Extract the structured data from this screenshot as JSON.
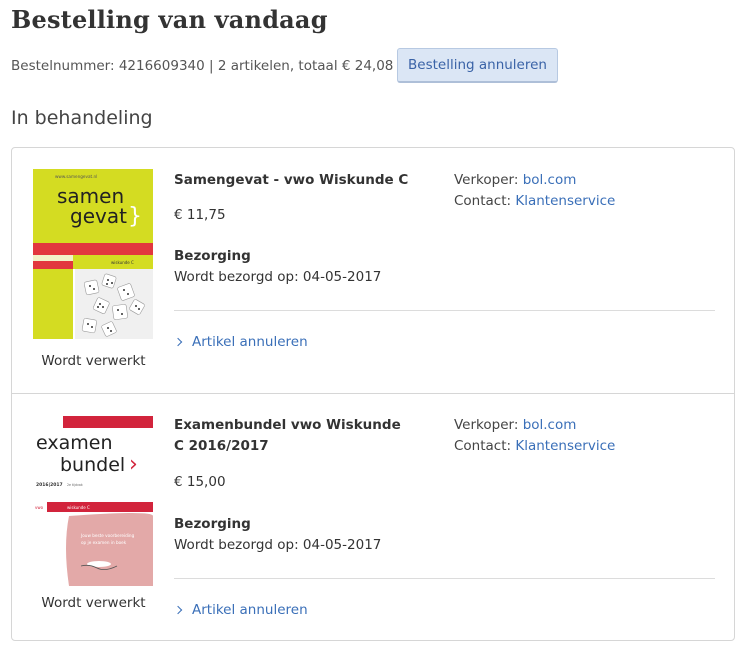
{
  "page": {
    "title": "Bestelling van vandaag",
    "order_summary": "Bestelnummer: 4216609340 | 2 artikelen, totaal € 24,08",
    "cancel_order_label": "Bestelling annuleren",
    "section_heading": "In behandeling"
  },
  "items": [
    {
      "title": "Samengevat - vwo Wiskunde C",
      "price": "€ 11,75",
      "delivery_label": "Bezorging",
      "delivery_date": "Wordt bezorgd op: 04-05-2017",
      "seller_label": "Verkoper:",
      "seller_name": "bol.com",
      "contact_label": "Contact:",
      "contact_name": "Klantenservice",
      "cancel_label": "Artikel annuleren",
      "status": "Wordt verwerkt",
      "cover": {
        "line1": "samen",
        "line2": "gevat",
        "site": "www.samengevat.nl",
        "subject": "wiskunde C",
        "level": "vwo"
      }
    },
    {
      "title": "Examenbundel vwo Wiskunde C 2016/2017",
      "price": "€ 15,00",
      "delivery_label": "Bezorging",
      "delivery_date": "Wordt bezorgd op: 04-05-2017",
      "seller_label": "Verkoper:",
      "seller_name": "bol.com",
      "contact_label": "Contact:",
      "contact_name": "Klantenservice",
      "cancel_label": "Artikel annuleren",
      "status": "Wordt verwerkt",
      "cover": {
        "line1": "examen",
        "line2": "bundel",
        "year": "2016|2017",
        "level": "vwo",
        "subject": "wiskunde C",
        "tagline1": "Jouw beste voorbereiding",
        "tagline2": "op je examen in boek"
      }
    }
  ],
  "colors": {
    "link": "#3a6fb8",
    "button_bg": "#dbe6f5",
    "cover1_green": "#d4dc22",
    "cover1_red": "#e2373e",
    "cover2_red": "#d2243c",
    "cover2_pink": "#e3a9a8"
  }
}
